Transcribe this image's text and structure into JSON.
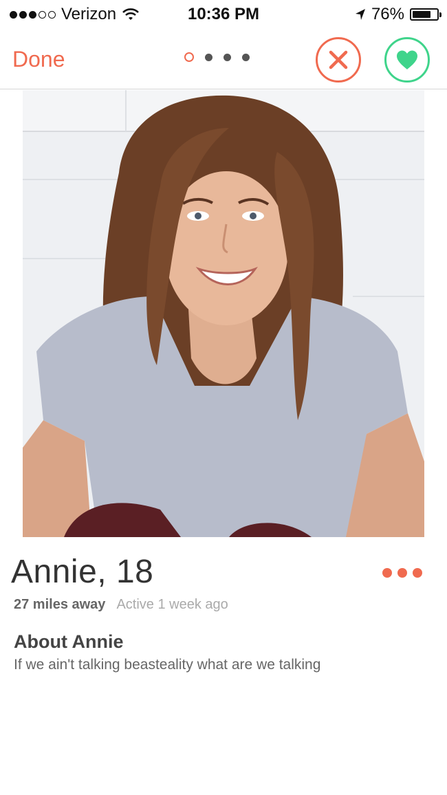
{
  "status_bar": {
    "carrier": "Verizon",
    "time": "10:36 PM",
    "battery_percent": "76%",
    "battery_level": 0.76,
    "signal_bars_filled": 3,
    "signal_bars_total": 5,
    "icons": [
      "wifi-icon",
      "location-arrow-icon",
      "battery-icon"
    ]
  },
  "nav": {
    "done_label": "Done",
    "photo_pages_total": 4,
    "photo_page_current": 1,
    "pass_icon": "x-icon",
    "like_icon": "heart-icon"
  },
  "colors": {
    "accent": "#f06a4f",
    "like": "#3fd48b"
  },
  "profile": {
    "name_age": "Annie, 18",
    "distance": "27 miles away",
    "active": "Active 1 week ago",
    "about_title": "About Annie",
    "about_text": "If we ain't talking beasteality what are we talking"
  }
}
